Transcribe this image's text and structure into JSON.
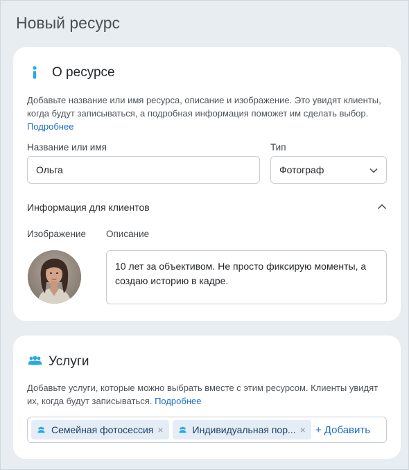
{
  "page": {
    "title": "Новый ресурс"
  },
  "about": {
    "title": "О ресурсе",
    "icon": "info-icon",
    "description": "Добавьте название или имя ресурса, описание и изображение. Это увидят клиенты, когда будут записываться, а подробная информация поможет им сделать выбор.",
    "more_link": "Подробнее",
    "name_label": "Название или имя",
    "name_value": "Ольга",
    "type_label": "Тип",
    "type_value": "Фотограф",
    "client_info_label": "Информация для клиентов",
    "image_label": "Изображение",
    "description_label": "Описание",
    "description_value": "10 лет за объективом. Не просто фиксирую моменты, а создаю историю в кадре."
  },
  "services": {
    "title": "Услуги",
    "icon": "people-icon",
    "description": "Добавьте услуги, которые можно выбрать вместе с этим ресурсом. Клиенты увидят их, когда будут записываться.",
    "more_link": "Подробнее",
    "tags": [
      {
        "label": "Семейная фотосессия",
        "remove": "×"
      },
      {
        "label": "Индивидуальная пор...",
        "remove": "×"
      }
    ],
    "add_label": "+ Добавить"
  },
  "colors": {
    "background": "#e8edf2",
    "card": "#ffffff",
    "accent": "#1f6fc4",
    "icon_blue": "#29a8e0",
    "tag_bg": "#e4edf6"
  }
}
